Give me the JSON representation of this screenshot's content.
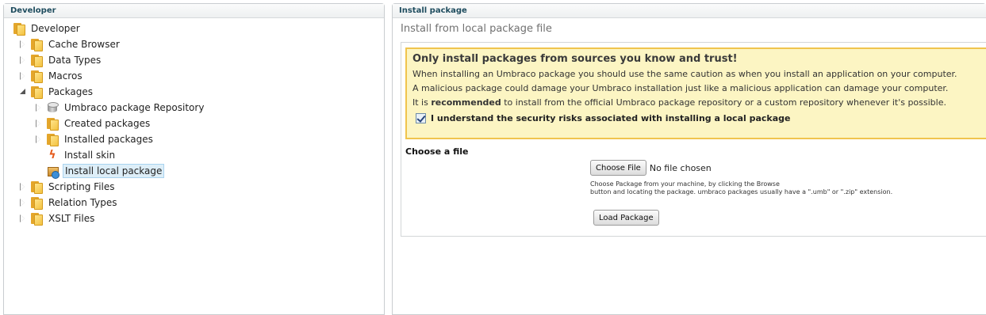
{
  "left_panel": {
    "title": "Developer",
    "tree": [
      {
        "label": "Developer",
        "icon": "folder-icon",
        "expander": "none",
        "depth": 0
      },
      {
        "label": "Cache Browser",
        "icon": "folder-icon",
        "expander": "collapsed",
        "depth": 1
      },
      {
        "label": "Data Types",
        "icon": "folder-icon",
        "expander": "collapsed",
        "depth": 1
      },
      {
        "label": "Macros",
        "icon": "folder-icon",
        "expander": "collapsed",
        "depth": 1
      },
      {
        "label": "Packages",
        "icon": "folder-icon",
        "expander": "expanded",
        "depth": 1
      },
      {
        "label": "Umbraco package Repository",
        "icon": "database-icon",
        "expander": "collapsed",
        "depth": 2
      },
      {
        "label": "Created packages",
        "icon": "folder-icon",
        "expander": "collapsed",
        "depth": 2
      },
      {
        "label": "Installed packages",
        "icon": "folder-icon",
        "expander": "collapsed",
        "depth": 2
      },
      {
        "label": "Install skin",
        "icon": "lightning-icon",
        "expander": "none",
        "depth": 2
      },
      {
        "label": "Install local package",
        "icon": "package-icon",
        "expander": "none",
        "depth": 2,
        "selected": true
      },
      {
        "label": "Scripting Files",
        "icon": "folder-icon",
        "expander": "collapsed",
        "depth": 1
      },
      {
        "label": "Relation Types",
        "icon": "folder-icon",
        "expander": "collapsed",
        "depth": 1
      },
      {
        "label": "XSLT Files",
        "icon": "folder-icon",
        "expander": "collapsed",
        "depth": 1
      }
    ]
  },
  "right_panel": {
    "title": "Install package",
    "subtitle": "Install from local package file",
    "notice": {
      "title": "Only install packages from sources you know and trust!",
      "line1": "When installing an Umbraco package you should use the same caution as when you install an application on your computer.",
      "line2": "A malicious package could damage your Umbraco installation just like a malicious application can damage your computer.",
      "line3_pre": "It is ",
      "line3_bold": "recommended",
      "line3_post": " to install from the official Umbraco package repository or a custom repository whenever it's possible.",
      "agree_label": "I understand the security risks associated with installing a local package",
      "agree_checked": true
    },
    "choose_file_label": "Choose a file",
    "file_button": "Choose File",
    "file_status": "No file chosen",
    "help_line1": "Choose Package from your machine, by clicking the Browse",
    "help_line2": "button and locating the package. umbraco packages usually have a \".umb\" or \".zip\" extension.",
    "load_button": "Load Package"
  },
  "colors": {
    "header_text": "#1e4c5e",
    "notice_bg": "#fcf5c3",
    "notice_border": "#f0c44d",
    "selected_bg": "#ddeef8"
  }
}
